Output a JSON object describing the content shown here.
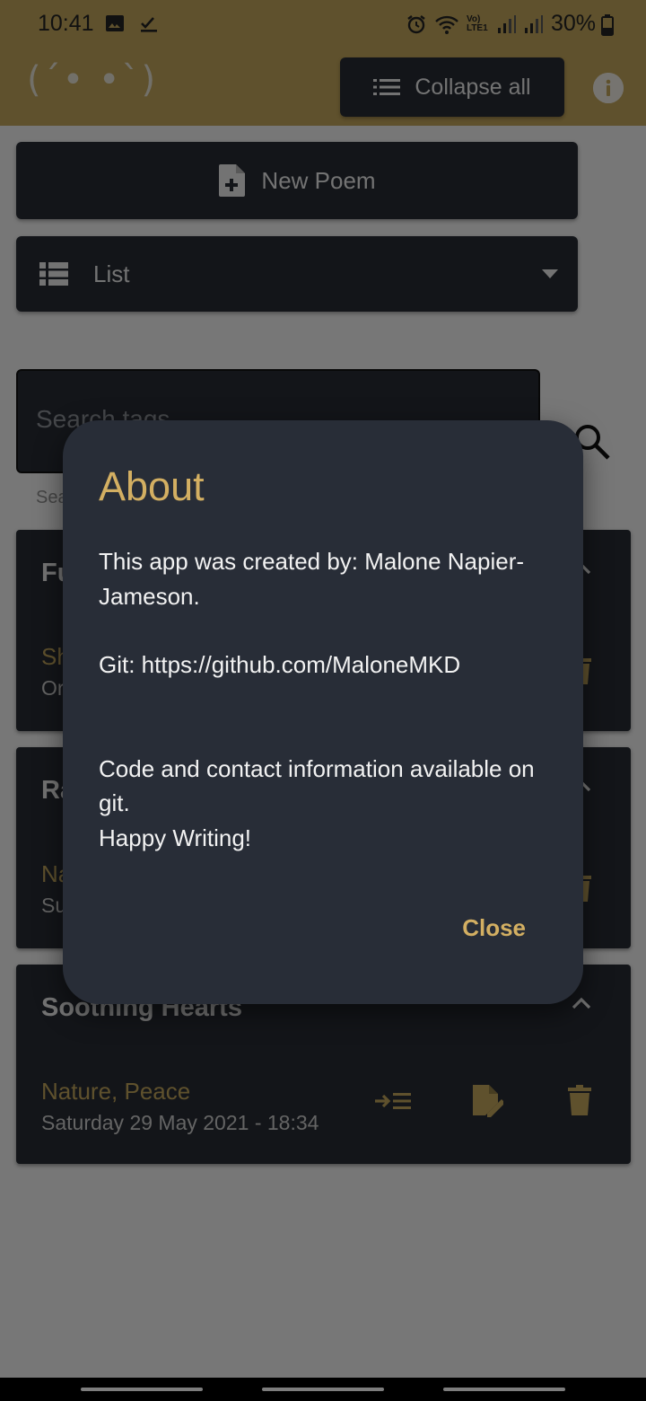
{
  "status": {
    "time": "10:41",
    "battery": "30%",
    "network": "Vo) LTE1"
  },
  "appbar": {
    "logo": "(´• •`)",
    "collapse_label": "Collapse all"
  },
  "controls": {
    "new_poem_label": "New Poem",
    "view_select_value": "List"
  },
  "search": {
    "placeholder": "Search tags",
    "helper": "Search by tag"
  },
  "cards": [
    {
      "title": "Fu",
      "tags": "Sh",
      "date": "Or"
    },
    {
      "title": "Ra",
      "tags": "Na",
      "date": "Su"
    },
    {
      "title": "Soothing Hearts",
      "tags": "Nature, Peace",
      "date": "Saturday 29 May 2021 - 18:34"
    }
  ],
  "dialog": {
    "title": "About",
    "line1": "This app was created by: Malone Napier-Jameson.",
    "line2": "Git: https://github.com/MaloneMKD",
    "line3": "Code and contact information available on git.",
    "line4": "Happy Writing!",
    "close_label": "Close"
  },
  "colors": {
    "accent": "#bfa35a",
    "dialog_accent": "#d3af62",
    "surface": "#262b33",
    "dialog_bg": "#282d37"
  }
}
